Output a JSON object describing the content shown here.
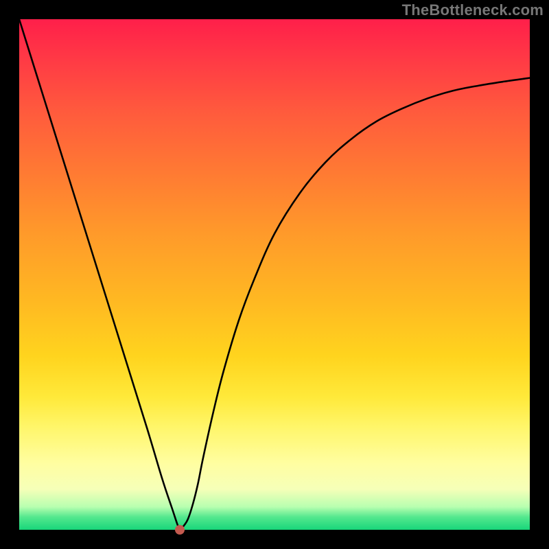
{
  "watermark": "TheBottleneck.com",
  "chart_data": {
    "type": "line",
    "title": "",
    "xlabel": "",
    "ylabel": "",
    "xlim": [
      0,
      100
    ],
    "ylim": [
      0,
      100
    ],
    "series": [
      {
        "name": "curve",
        "x": [
          0,
          5,
          10,
          15,
          20,
          25,
          28,
          30,
          31,
          31.5,
          32,
          33,
          34,
          35,
          36,
          38,
          40,
          43,
          46,
          50,
          55,
          60,
          65,
          70,
          75,
          80,
          85,
          90,
          95,
          100
        ],
        "y": [
          100,
          84,
          68,
          52,
          36,
          20,
          10,
          4,
          1,
          0,
          0.5,
          2,
          5,
          9,
          14,
          23,
          31,
          41,
          49,
          58,
          66,
          72,
          76.5,
          80,
          82.5,
          84.5,
          86,
          87,
          87.8,
          88.5
        ]
      }
    ],
    "marker": {
      "x": 31.5,
      "y": 0
    },
    "legend": false,
    "grid": false
  },
  "colors": {
    "curve": "#000000",
    "marker": "#c45a4f",
    "background_top": "#ff1f4a",
    "background_bottom": "#18d67a",
    "frame": "#000000"
  }
}
